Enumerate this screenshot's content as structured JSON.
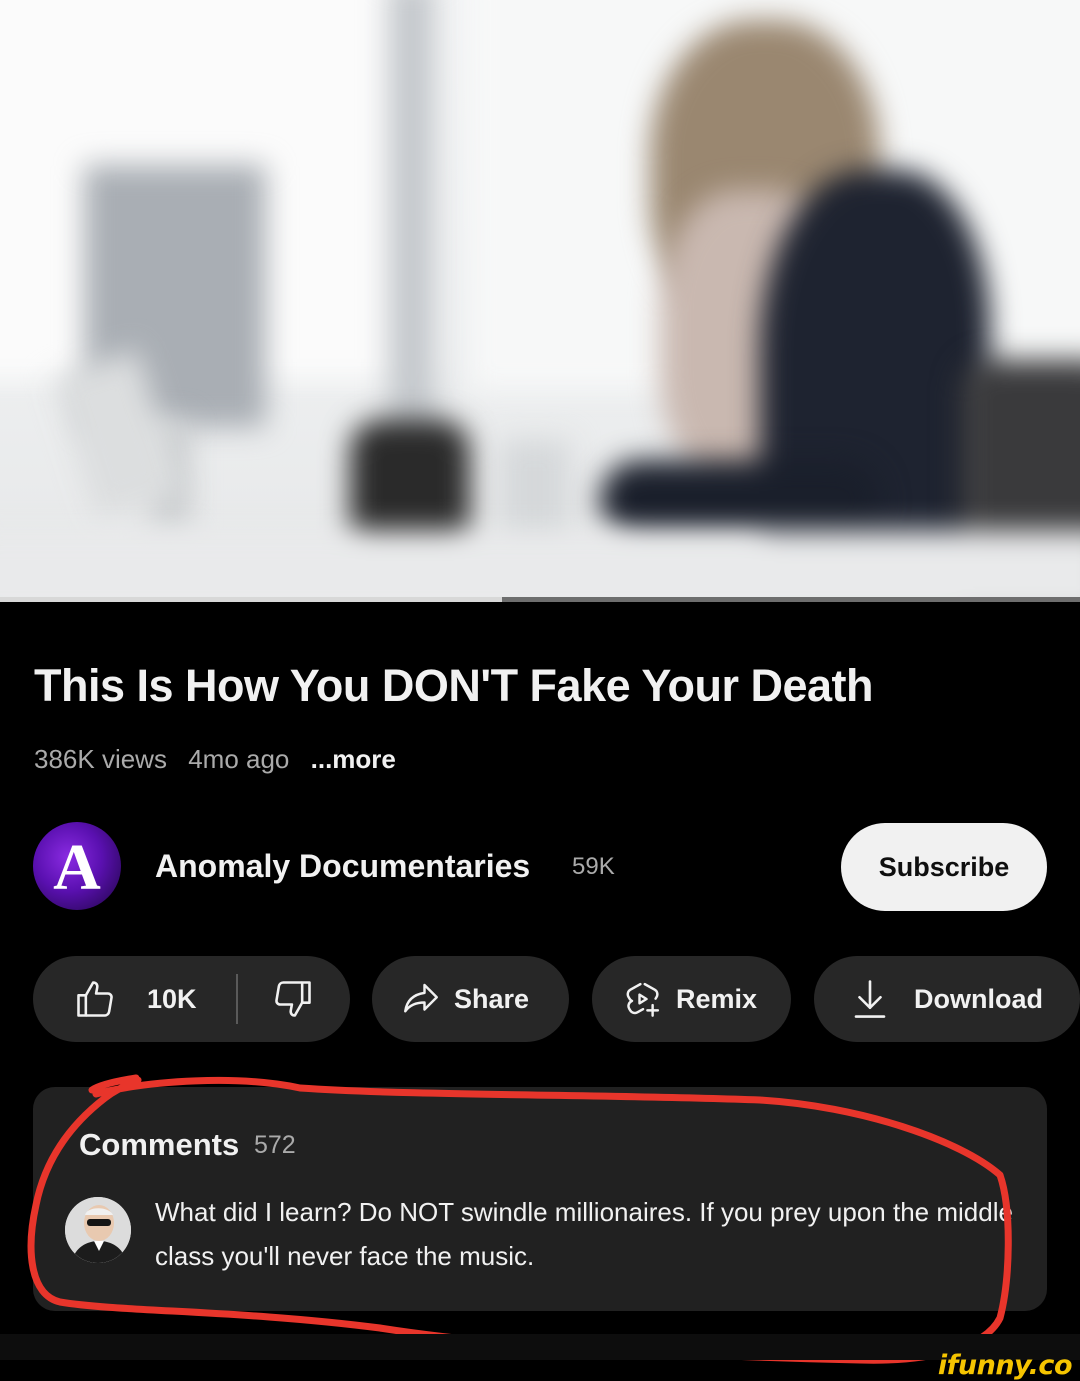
{
  "video": {
    "progress_fraction": 0.465
  },
  "title": "This Is How You DON'T Fake Your Death",
  "meta": {
    "views": "386K views",
    "age": "4mo ago",
    "more": "...more"
  },
  "channel": {
    "avatar_letter": "A",
    "name": "Anomaly Documentaries",
    "subscribers": "59K",
    "subscribe_label": "Subscribe"
  },
  "actions": {
    "like_count": "10K",
    "share_label": "Share",
    "remix_label": "Remix",
    "download_label": "Download"
  },
  "comments": {
    "heading": "Comments",
    "count": "572",
    "top_comment": "What did I learn?  Do NOT swindle millionaires.  If you prey upon the middle class you'll never face the music."
  },
  "watermark": "ifunny.co",
  "colors": {
    "annotation": "#e8352b",
    "watermark": "#f5c400"
  }
}
